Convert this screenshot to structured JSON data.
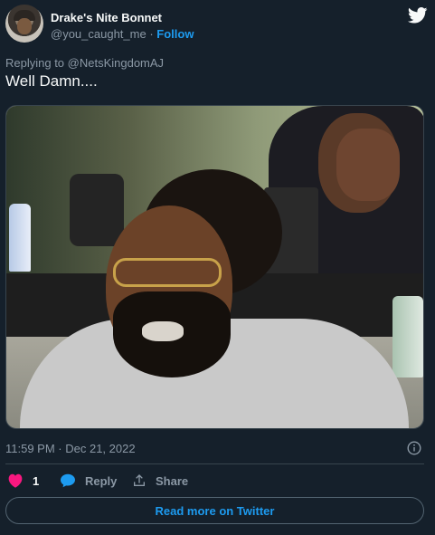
{
  "author": {
    "name": "Drake's Nite Bonnet",
    "handle": "@you_caught_me",
    "separator": " · ",
    "follow_label": "Follow"
  },
  "tweet": {
    "replying_to": "Replying to @NetsKingdomAJ",
    "text": "Well Damn....",
    "timestamp": "11:59 PM · Dec 21, 2022"
  },
  "actions": {
    "like_count": "1",
    "reply_label": "Reply",
    "share_label": "Share"
  },
  "footer": {
    "read_more_label": "Read more on Twitter"
  },
  "colors": {
    "background": "#15202b",
    "accent": "#1d9bf0",
    "like": "#f91880",
    "muted": "#8b98a5"
  },
  "icons": [
    "twitter-bird-icon",
    "info-icon",
    "heart-icon",
    "reply-bubble-icon",
    "share-icon"
  ]
}
